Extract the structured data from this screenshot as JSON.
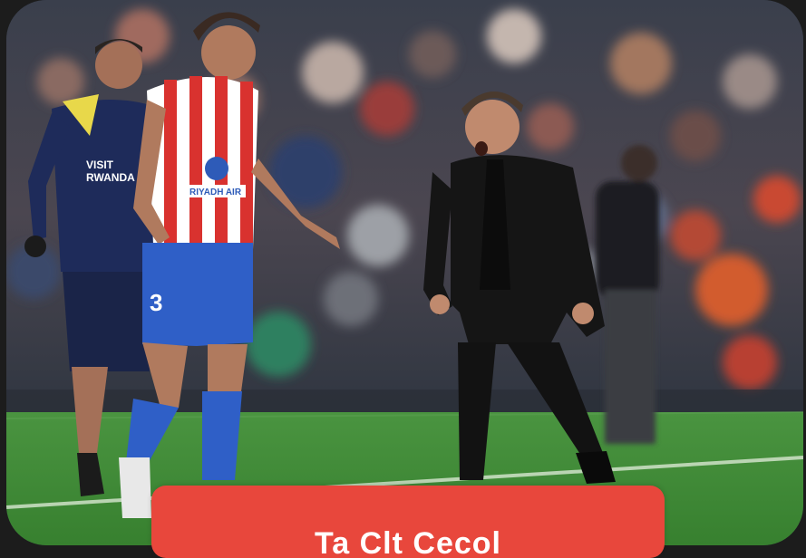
{
  "photo": {
    "jersey_sponsor": "RIYADH AIR",
    "shorts_number": "3",
    "trainer_shirt_text": "VISIT RWANDA"
  },
  "cta_button": {
    "label": "Ta Clt Cecol"
  },
  "colors": {
    "cta_background": "#e8473c",
    "frame": "#1c1c1c",
    "pitch": "#3f8a3a"
  }
}
